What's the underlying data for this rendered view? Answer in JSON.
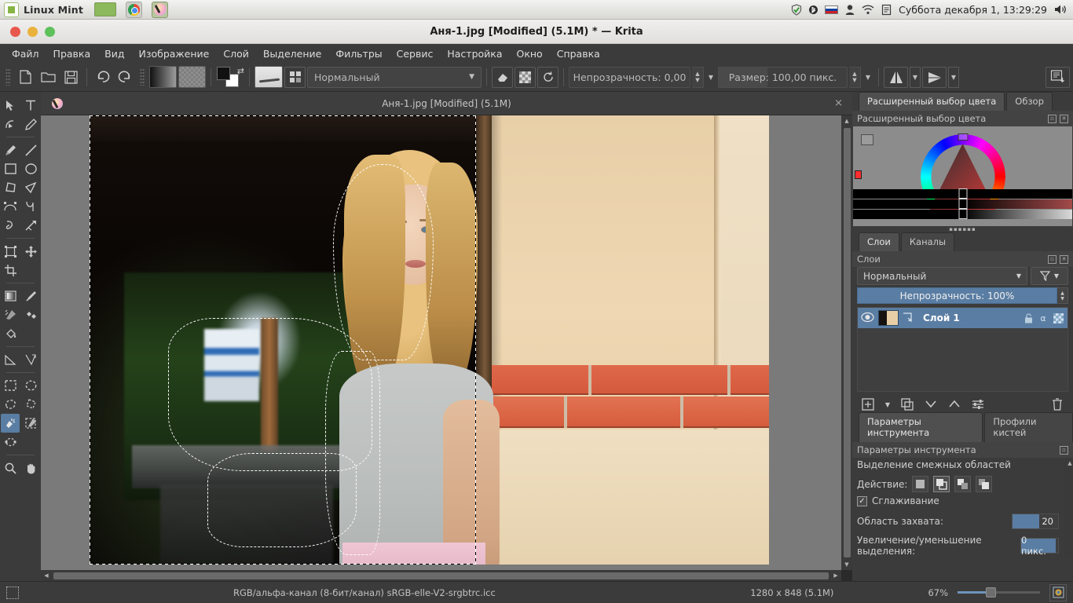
{
  "system_bar": {
    "menu_label": "Linux Mint",
    "taskbar_items": [
      {
        "name": "window-button",
        "icon": "window-icon"
      },
      {
        "name": "chrome",
        "icon": "chrome-icon"
      },
      {
        "name": "krita",
        "icon": "krita-icon"
      }
    ],
    "tray_icons": [
      "shield-icon",
      "bluetooth-icon",
      "flag-ru-icon",
      "user-icon",
      "wifi-icon",
      "clipboard-icon"
    ],
    "clock": "Суббота декабря  1, 13:29:29",
    "volume_icon": "volume-icon"
  },
  "window": {
    "title": "Аня-1.jpg [Modified]  (5.1M) * — Krita",
    "buttons": [
      "close",
      "minimize",
      "maximize"
    ]
  },
  "menu_bar": {
    "items": [
      {
        "label": "Файл",
        "name": "menu-file"
      },
      {
        "label": "Правка",
        "name": "menu-edit"
      },
      {
        "label": "Вид",
        "name": "menu-view"
      },
      {
        "label": "Изображение",
        "name": "menu-image"
      },
      {
        "label": "Слой",
        "name": "menu-layer"
      },
      {
        "label": "Выделение",
        "name": "menu-select"
      },
      {
        "label": "Фильтры",
        "name": "menu-filters"
      },
      {
        "label": "Сервис",
        "name": "menu-tools"
      },
      {
        "label": "Настройка",
        "name": "menu-settings"
      },
      {
        "label": "Окно",
        "name": "menu-window"
      },
      {
        "label": "Справка",
        "name": "menu-help"
      }
    ]
  },
  "toolbar": {
    "new_icon": "new-document-icon",
    "open_icon": "open-folder-icon",
    "save_icon": "save-icon",
    "undo_icon": "undo-icon",
    "redo_icon": "redo-icon",
    "gradient_swatch": "gradient-swatch",
    "pattern_swatch": "pattern-swatch",
    "fgbg_swatch": "foreground-background-swatch",
    "brush_preset": "brush-preset-preview",
    "brush_editor_icon": "brush-editor-icon",
    "blend_mode": "Нормальный",
    "eraser_icon": "eraser-icon",
    "alpha_icon": "preserve-alpha-icon",
    "reload_icon": "reload-preset-icon",
    "opacity_label": "Непрозрачность:  0,00",
    "size_label": "Размер:  100,00 пикс.",
    "mirror_h_icon": "mirror-horizontal-icon",
    "mirror_v_icon": "mirror-vertical-icon",
    "workspace_icon": "workspace-chooser-icon"
  },
  "toolbox": {
    "tools": [
      {
        "name": "tool-select-shapes",
        "icon": "arrow-cursor-icon",
        "selected": false
      },
      {
        "name": "tool-text",
        "icon": "text-T-icon",
        "selected": false
      },
      {
        "name": "tool-edit-shapes",
        "icon": "edit-shapes-icon",
        "selected": false
      },
      {
        "name": "tool-calligraphy",
        "icon": "calligraphy-pen-icon",
        "selected": false
      },
      {
        "name": "tool-freehand-brush",
        "icon": "paintbrush-icon",
        "selected": false
      },
      {
        "name": "tool-line",
        "icon": "line-icon",
        "selected": false
      },
      {
        "name": "tool-rectangle",
        "icon": "rectangle-icon",
        "selected": false
      },
      {
        "name": "tool-ellipse",
        "icon": "ellipse-icon",
        "selected": false
      },
      {
        "name": "tool-polygon",
        "icon": "polygon-icon",
        "selected": false
      },
      {
        "name": "tool-polyline",
        "icon": "polyline-icon",
        "selected": false
      },
      {
        "name": "tool-bezier-curve",
        "icon": "bezier-curve-icon",
        "selected": false
      },
      {
        "name": "tool-freehand-path",
        "icon": "freehand-path-icon",
        "selected": false
      },
      {
        "name": "tool-dynamic-brush",
        "icon": "dynamic-brush-icon",
        "selected": false
      },
      {
        "name": "tool-multibrush",
        "icon": "multibrush-icon",
        "selected": false
      },
      {
        "name": "tool-transform",
        "icon": "transform-icon",
        "selected": false
      },
      {
        "name": "tool-move",
        "icon": "move-cross-icon",
        "selected": false
      },
      {
        "name": "tool-crop",
        "icon": "crop-icon",
        "selected": false
      },
      {
        "name": "tool-gradient",
        "icon": "gradient-icon",
        "selected": false
      },
      {
        "name": "tool-color-picker",
        "icon": "eyedropper-icon",
        "selected": false
      },
      {
        "name": "tool-colorize-mask",
        "icon": "colorize-mask-icon",
        "selected": false
      },
      {
        "name": "tool-smart-patch",
        "icon": "smart-patch-icon",
        "selected": false
      },
      {
        "name": "tool-fill",
        "icon": "paint-bucket-icon",
        "selected": false
      },
      {
        "name": "tool-measure",
        "icon": "measure-icon",
        "selected": false
      },
      {
        "name": "tool-assistant",
        "icon": "assistant-icon",
        "selected": false
      },
      {
        "name": "tool-rect-select",
        "icon": "rectangular-select-icon",
        "selected": false
      },
      {
        "name": "tool-ellipse-select",
        "icon": "elliptical-select-icon",
        "selected": false
      },
      {
        "name": "tool-freehand-select",
        "icon": "freehand-select-icon",
        "selected": false
      },
      {
        "name": "tool-polygon-select",
        "icon": "polygonal-select-icon",
        "selected": false
      },
      {
        "name": "tool-contiguous-select",
        "icon": "magic-wand-icon",
        "selected": true
      },
      {
        "name": "tool-similar-select",
        "icon": "similar-color-select-icon",
        "selected": false
      },
      {
        "name": "tool-bezier-select",
        "icon": "bezier-select-icon",
        "selected": false
      },
      {
        "name": "tool-zoom",
        "icon": "magnifier-icon",
        "selected": false
      },
      {
        "name": "tool-pan",
        "icon": "hand-icon",
        "selected": false
      }
    ]
  },
  "document_tab": {
    "icon": "krita-document-icon",
    "title": "Аня-1.jpg [Modified]  (5.1M)",
    "close_label": "×"
  },
  "color_dock": {
    "tabs": [
      {
        "label": "Расширенный выбор цвета",
        "active": true
      },
      {
        "label": "Обзор",
        "active": false
      }
    ],
    "panel_title": "Расширенный выбор цвета",
    "float_icon": "float-dock-icon",
    "close_icon": "close-dock-icon",
    "menu_icon": "selector-settings-icon"
  },
  "layers_dock": {
    "tabs": [
      {
        "label": "Слои",
        "active": true
      },
      {
        "label": "Каналы",
        "active": false
      }
    ],
    "panel_title": "Слои",
    "blend_mode": "Нормальный",
    "filter_icon": "filter-funnel-icon",
    "opacity_label": "Непрозрачность:  100%",
    "layers": [
      {
        "name": "Слой 1",
        "visible_icon": "eye-icon",
        "thumbnail": "layer-thumbnail",
        "inherit_alpha_icon": "inherit-alpha-icon",
        "lock_icon": "unlocked-icon",
        "alpha_icon": "alpha-icon",
        "alpha_lock_icon": "alpha-lock-icon",
        "selected": true
      }
    ],
    "buttons": [
      {
        "name": "add-layer-button",
        "icon": "plus-box-icon"
      },
      {
        "name": "add-layer-menu-button",
        "icon": "chevron-down-icon"
      },
      {
        "name": "duplicate-layer-button",
        "icon": "duplicate-icon"
      },
      {
        "name": "move-layer-down-button",
        "icon": "chevron-down-icon"
      },
      {
        "name": "move-layer-up-button",
        "icon": "chevron-up-icon"
      },
      {
        "name": "layer-properties-button",
        "icon": "sliders-icon"
      },
      {
        "name": "delete-layer-button",
        "icon": "trash-icon"
      }
    ]
  },
  "tool_options": {
    "tabs": [
      {
        "label": "Параметры инструмента",
        "active": true
      },
      {
        "label": "Профили кистей",
        "active": false
      }
    ],
    "panel_title": "Параметры инструмента",
    "tool_name": "Выделение смежных областей",
    "action_label": "Действие:",
    "action_buttons": [
      {
        "name": "action-replace",
        "icon": "replace-selection-icon",
        "selected": false
      },
      {
        "name": "action-intersect",
        "icon": "intersect-selection-icon",
        "selected": true
      },
      {
        "name": "action-add",
        "icon": "add-selection-icon",
        "selected": false
      },
      {
        "name": "action-subtract",
        "icon": "subtract-selection-icon",
        "selected": false
      }
    ],
    "antialias_label": "Сглаживание",
    "antialias_checked": true,
    "fuzziness_label": "Область захвата:",
    "fuzziness_value": "20",
    "grow_label": "Увеличение/уменьшение выделения:",
    "grow_value": "0 пикс."
  },
  "status_bar": {
    "selection_icon": "selection-mask-icon",
    "color_profile": "RGB/альфа-канал (8-бит/канал)  sRGB-elle-V2-srgbtrc.icc",
    "dimensions": "1280 x 848 (5.1M)",
    "zoom": "67%",
    "zoom_preset_icon": "zoom-fit-icon"
  },
  "colors": {
    "accent_blue": "#5a7da3",
    "panel_bg": "#3b3b3b",
    "canvas_bg": "#7a7a7a",
    "foreground": "#111111",
    "background": "#ffffff"
  }
}
